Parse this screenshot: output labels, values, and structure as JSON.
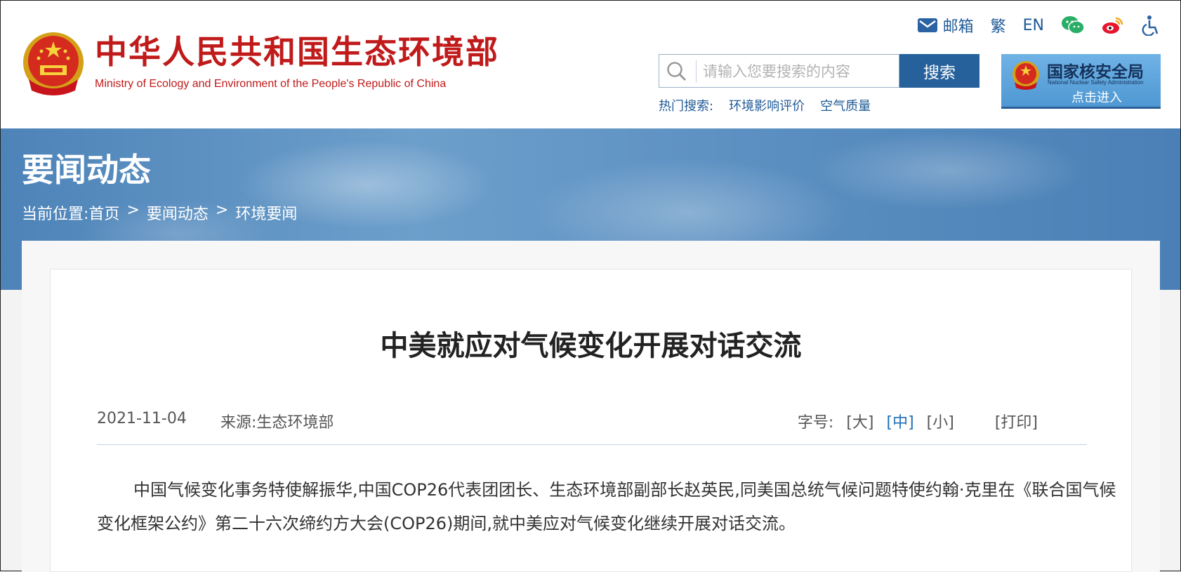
{
  "header": {
    "site_title": "中华人民共和国生态环境部",
    "site_subtitle": "Ministry of Ecology and Environment of the People's Republic of China",
    "top_links": {
      "mail": "邮箱",
      "traditional": "繁",
      "english": "EN",
      "icons": [
        "mail-icon",
        "wechat-icon",
        "weibo-icon",
        "accessibility-icon"
      ]
    },
    "search": {
      "placeholder": "请输入您要搜索的内容",
      "button": "搜索",
      "hot_label": "热门搜索:",
      "hot_items": [
        "环境影响评价",
        "空气质量"
      ]
    },
    "nsa_banner": {
      "title": "国家核安全局",
      "subtitle_en": "National Nuclear Safety Administration",
      "enter": "点击进入"
    }
  },
  "banner": {
    "section_title": "要闻动态",
    "breadcrumb": {
      "label": "当前位置:",
      "items": [
        "首页",
        "要闻动态",
        "环境要闻"
      ],
      "separator": ">"
    }
  },
  "article": {
    "title": "中美就应对气候变化开展对话交流",
    "date": "2021-11-04",
    "source": "来源:生态环境部",
    "font_size_label": "字号:",
    "font_sizes": [
      "[大]",
      "[中]",
      "[小]"
    ],
    "font_size_selected": "[中]",
    "print": "[打印]",
    "body": "中国气候变化事务特使解振华,中国COP26代表团团长、生态环境部副部长赵英民,同美国总统气候问题特使约翰·克里在《联合国气候变化框架公约》第二十六次缔约方大会(COP26)期间,就中美应对气候变化继续开展对话交流。"
  },
  "colors": {
    "brand_red": "#c01a1a",
    "link_blue": "#1f5a97",
    "search_button": "#26619b",
    "active_font_size": "#1f6fb5"
  }
}
